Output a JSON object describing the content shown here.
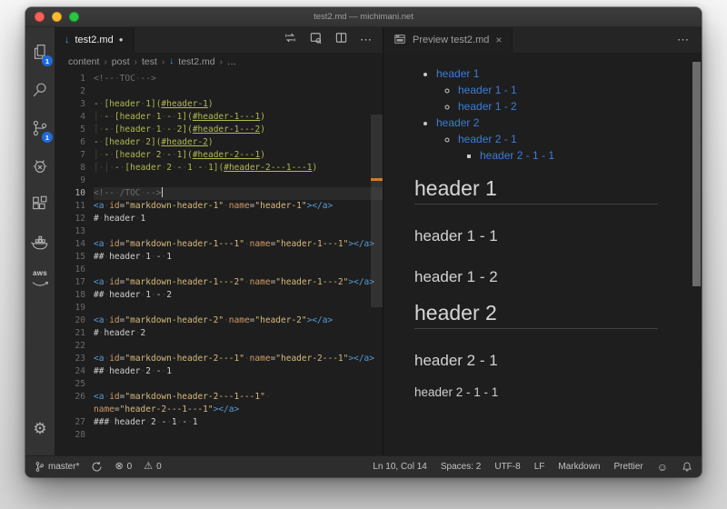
{
  "window": {
    "title": "test2.md — michimani.net"
  },
  "icons": {
    "md_arrow": "↓",
    "modified_dot": "●",
    "close": "×",
    "more": "⋯",
    "separator": "›",
    "gear": "⚙",
    "error": "⊗",
    "warning": "⚠",
    "smiley": "☺"
  },
  "colors": {
    "badge_blue": "#1e6bd8",
    "markdown_icon_blue": "#4a9fd8",
    "preview_link_blue": "#3b7dd6",
    "tag_blue": "#569cd6",
    "attribute_orange": "#d19a66",
    "string_gold": "#d7ba7d",
    "toc_olive": "#b0b84e",
    "comment_gray": "#6d6d6d",
    "modified_mark_orange": "#c87e30"
  },
  "activity_bar": {
    "explorer_badge": "1",
    "scm_badge": "1",
    "aws_label": "aws"
  },
  "editor": {
    "tab": {
      "label": "test2.md"
    },
    "breadcrumb": {
      "items": [
        {
          "label": "content"
        },
        {
          "label": "post"
        },
        {
          "label": "test"
        },
        {
          "label": "test2.md",
          "icon": "markdown"
        },
        {
          "label": "…"
        }
      ]
    },
    "lines": [
      {
        "n": "1",
        "tokens": [
          [
            "c",
            "<!-- TOC -->"
          ]
        ]
      },
      {
        "n": "2",
        "tokens": []
      },
      {
        "n": "3",
        "tokens": [
          [
            "t",
            "- [header 1]("
          ],
          [
            "l",
            "#header-1"
          ],
          [
            "t",
            ")"
          ]
        ]
      },
      {
        "n": "4",
        "tokens": [
          [
            "g",
            "│"
          ],
          [
            "t",
            " - [header 1 - 1]("
          ],
          [
            "l",
            "#header-1---1"
          ],
          [
            "t",
            ")"
          ]
        ]
      },
      {
        "n": "5",
        "tokens": [
          [
            "g",
            "│"
          ],
          [
            "t",
            " - [header 1 - 2]("
          ],
          [
            "l",
            "#header-1---2"
          ],
          [
            "t",
            ")"
          ]
        ]
      },
      {
        "n": "6",
        "tokens": [
          [
            "t",
            "- [header 2]("
          ],
          [
            "l",
            "#header-2"
          ],
          [
            "t",
            ")"
          ]
        ]
      },
      {
        "n": "7",
        "tokens": [
          [
            "g",
            "│"
          ],
          [
            "t",
            " - [header 2 - 1]("
          ],
          [
            "l",
            "#header-2---1"
          ],
          [
            "t",
            ")"
          ]
        ]
      },
      {
        "n": "8",
        "tokens": [
          [
            "g",
            "│"
          ],
          [
            "t",
            " "
          ],
          [
            "g",
            "│"
          ],
          [
            "t",
            " - [header 2 - 1 - 1]("
          ],
          [
            "l",
            "#header-2---1---1"
          ],
          [
            "t",
            ")"
          ]
        ]
      },
      {
        "n": "9",
        "tokens": []
      },
      {
        "n": "10",
        "current": true,
        "cursor": true,
        "tokens": [
          [
            "c",
            "<!-- /TOC -->"
          ]
        ]
      },
      {
        "n": "11",
        "tokens": [
          [
            "tag",
            "<a"
          ],
          [
            "d",
            " "
          ],
          [
            "at",
            "id"
          ],
          [
            "d",
            "="
          ],
          [
            "st",
            "\"markdown-header-1\""
          ],
          [
            "d",
            " "
          ],
          [
            "at",
            "name"
          ],
          [
            "d",
            "="
          ],
          [
            "st",
            "\"header-1\""
          ],
          [
            "tag",
            "></a>"
          ]
        ]
      },
      {
        "n": "12",
        "tokens": [
          [
            "p",
            "# header 1"
          ]
        ]
      },
      {
        "n": "13",
        "tokens": []
      },
      {
        "n": "14",
        "tokens": [
          [
            "tag",
            "<a"
          ],
          [
            "d",
            " "
          ],
          [
            "at",
            "id"
          ],
          [
            "d",
            "="
          ],
          [
            "st",
            "\"markdown-header-1---1\""
          ],
          [
            "d",
            " "
          ],
          [
            "at",
            "name"
          ],
          [
            "d",
            "="
          ],
          [
            "st",
            "\"header-1---1\""
          ],
          [
            "tag",
            "></a>"
          ]
        ]
      },
      {
        "n": "15",
        "tokens": [
          [
            "p",
            "## header 1 - 1"
          ]
        ]
      },
      {
        "n": "16",
        "tokens": []
      },
      {
        "n": "17",
        "tokens": [
          [
            "tag",
            "<a"
          ],
          [
            "d",
            " "
          ],
          [
            "at",
            "id"
          ],
          [
            "d",
            "="
          ],
          [
            "st",
            "\"markdown-header-1---2\""
          ],
          [
            "d",
            " "
          ],
          [
            "at",
            "name"
          ],
          [
            "d",
            "="
          ],
          [
            "st",
            "\"header-1---2\""
          ],
          [
            "tag",
            "></a>"
          ]
        ]
      },
      {
        "n": "18",
        "tokens": [
          [
            "p",
            "## header 1 - 2"
          ]
        ]
      },
      {
        "n": "19",
        "tokens": []
      },
      {
        "n": "20",
        "tokens": [
          [
            "tag",
            "<a"
          ],
          [
            "d",
            " "
          ],
          [
            "at",
            "id"
          ],
          [
            "d",
            "="
          ],
          [
            "st",
            "\"markdown-header-2\""
          ],
          [
            "d",
            " "
          ],
          [
            "at",
            "name"
          ],
          [
            "d",
            "="
          ],
          [
            "st",
            "\"header-2\""
          ],
          [
            "tag",
            "></a>"
          ]
        ]
      },
      {
        "n": "21",
        "tokens": [
          [
            "p",
            "# header 2"
          ]
        ]
      },
      {
        "n": "22",
        "tokens": []
      },
      {
        "n": "23",
        "tokens": [
          [
            "tag",
            "<a"
          ],
          [
            "d",
            " "
          ],
          [
            "at",
            "id"
          ],
          [
            "d",
            "="
          ],
          [
            "st",
            "\"markdown-header-2---1\""
          ],
          [
            "d",
            " "
          ],
          [
            "at",
            "name"
          ],
          [
            "d",
            "="
          ],
          [
            "st",
            "\"header-2---1\""
          ],
          [
            "tag",
            "></a>"
          ]
        ]
      },
      {
        "n": "24",
        "tokens": [
          [
            "p",
            "## header 2 - 1"
          ]
        ]
      },
      {
        "n": "25",
        "tokens": []
      },
      {
        "n": "26",
        "tokens": [
          [
            "tag",
            "<a"
          ],
          [
            "d",
            " "
          ],
          [
            "at",
            "id"
          ],
          [
            "d",
            "="
          ],
          [
            "st",
            "\"markdown-header-2---1---1\""
          ],
          [
            "d",
            " "
          ]
        ]
      },
      {
        "n": "",
        "tokens": [
          [
            "at",
            "name"
          ],
          [
            "d",
            "="
          ],
          [
            "st",
            "\"header-2---1---1\""
          ],
          [
            "tag",
            "></a>"
          ]
        ]
      },
      {
        "n": "27",
        "tokens": [
          [
            "p",
            "### header 2 - 1 - 1"
          ]
        ]
      },
      {
        "n": "28",
        "tokens": []
      }
    ]
  },
  "preview": {
    "tab": {
      "label": "Preview test2.md"
    },
    "toc": [
      {
        "text": "header 1",
        "children": [
          {
            "text": "header 1 - 1"
          },
          {
            "text": "header 1 - 2"
          }
        ]
      },
      {
        "text": "header 2",
        "children": [
          {
            "text": "header 2 - 1",
            "children": [
              {
                "text": "header 2 - 1 - 1"
              }
            ]
          }
        ]
      }
    ],
    "blocks": [
      {
        "type": "h1",
        "text": "header 1"
      },
      {
        "type": "h2",
        "text": "header 1 - 1"
      },
      {
        "type": "h2",
        "text": "header 1 - 2"
      },
      {
        "type": "h1",
        "text": "header 2"
      },
      {
        "type": "h2",
        "text": "header 2 - 1"
      },
      {
        "type": "h3",
        "text": "header 2 - 1 - 1"
      }
    ]
  },
  "status_bar": {
    "branch": "master*",
    "errors": "0",
    "warnings": "0",
    "right_items": [
      "Ln 10, Col 14",
      "Spaces: 2",
      "UTF-8",
      "LF",
      "Markdown",
      "Prettier"
    ]
  }
}
